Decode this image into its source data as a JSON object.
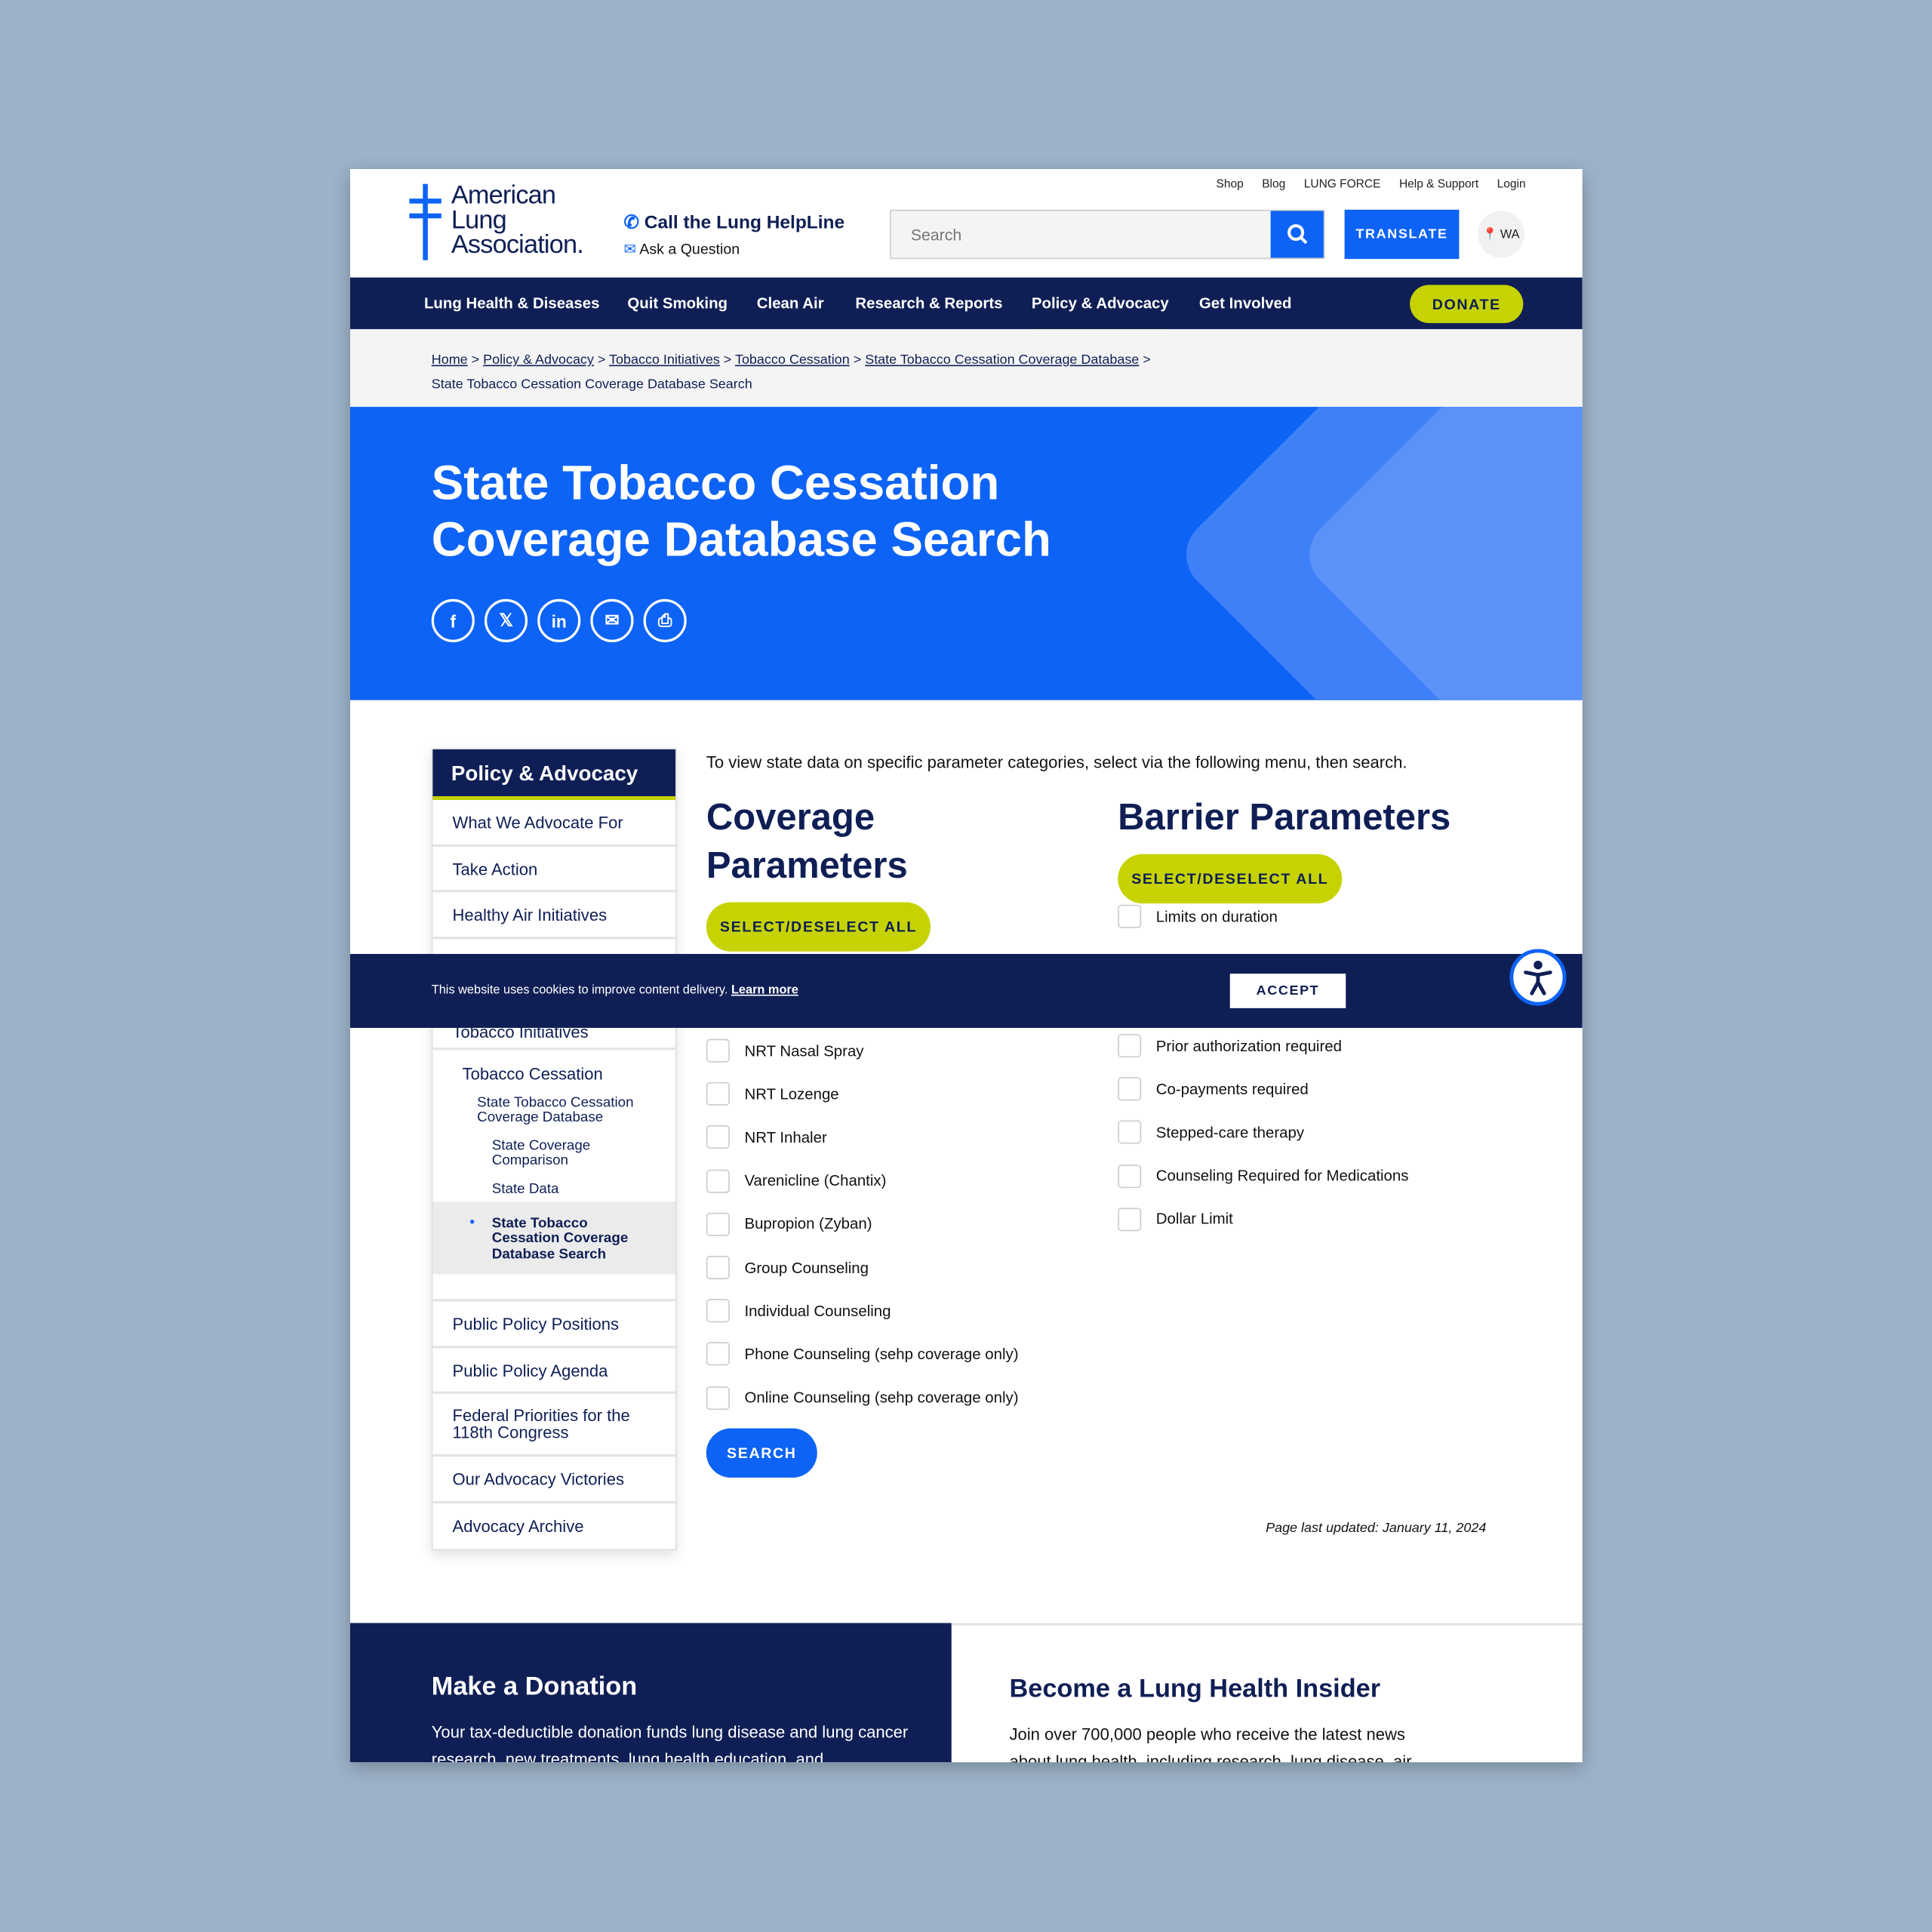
{
  "header": {
    "logo": [
      "American",
      "Lung",
      "Association."
    ],
    "top_links": [
      "Shop",
      "Blog",
      "LUNG FORCE",
      "Help & Support",
      "Login"
    ],
    "helpline": "Call the Lung HelpLine",
    "ask": "Ask a Question",
    "search_placeholder": "Search",
    "translate": "TRANSLATE",
    "location": "WA"
  },
  "nav": {
    "items": [
      "Lung Health & Diseases",
      "Quit Smoking",
      "Clean Air",
      "Research & Reports",
      "Policy & Advocacy",
      "Get Involved"
    ],
    "active": "Policy & Advocacy",
    "donate": "DONATE"
  },
  "breadcrumb": {
    "links": [
      "Home",
      "Policy & Advocacy",
      "Tobacco Initiatives",
      "Tobacco Cessation",
      "State Tobacco Cessation Coverage Database"
    ],
    "current": "State Tobacco Cessation Coverage Database Search"
  },
  "hero": {
    "title": "State Tobacco Cessation Coverage Database Search",
    "share": [
      "facebook-icon",
      "x-icon",
      "linkedin-icon",
      "email-icon",
      "print-icon"
    ]
  },
  "sidebar": {
    "title": "Policy & Advocacy",
    "top_items": [
      "What We Advocate For",
      "Take Action",
      "Healthy Air Initiatives"
    ],
    "partial_item": "Tobacco Initiatives",
    "sub": {
      "parent": "Tobacco Cessation",
      "child": "State Tobacco Cessation Coverage Database",
      "grandchildren": [
        "State Coverage Comparison",
        "State Data"
      ],
      "active": "State Tobacco Cessation Coverage Database Search"
    },
    "bottom_items": [
      "Public Policy Positions",
      "Public Policy Agenda",
      "Federal Priorities for the 118th Congress",
      "Our Advocacy Victories",
      "Advocacy Archive"
    ]
  },
  "main": {
    "intro": "To view state data on specific parameter categories, select via the following menu, then search.",
    "coverage_title": "Coverage Parameters",
    "barrier_title": "Barrier Parameters",
    "select_all": "SELECT/DESELECT ALL",
    "coverage_items": [
      "NRT Nasal Spray",
      "NRT Lozenge",
      "NRT Inhaler",
      "Varenicline (Chantix)",
      "Bupropion (Zyban)",
      "Group Counseling",
      "Individual Counseling",
      "Phone Counseling (sehp coverage only)",
      "Online Counseling (sehp coverage only)"
    ],
    "barrier_top": "Limits on duration",
    "barrier_items": [
      "Prior authorization required",
      "Co-payments required",
      "Stepped-care therapy",
      "Counseling Required for Medications",
      "Dollar Limit"
    ],
    "search": "SEARCH",
    "updated": "Page last updated: January 11, 2024"
  },
  "cookie": {
    "text": "This website uses cookies to improve content delivery.",
    "learn": "Learn more",
    "accept": "ACCEPT"
  },
  "footer": {
    "donate_title": "Make a Donation",
    "donate_text": "Your tax-deductible donation funds lung disease and lung cancer research, new treatments, lung health education, and",
    "insider_title": "Become a Lung Health Insider",
    "insider_text": "Join over 700,000 people who receive the latest news about lung health, including research, lung disease, air"
  },
  "colors": {
    "navy": "#0f1f55",
    "blue": "#0d63f5",
    "lime": "#c6d300"
  }
}
